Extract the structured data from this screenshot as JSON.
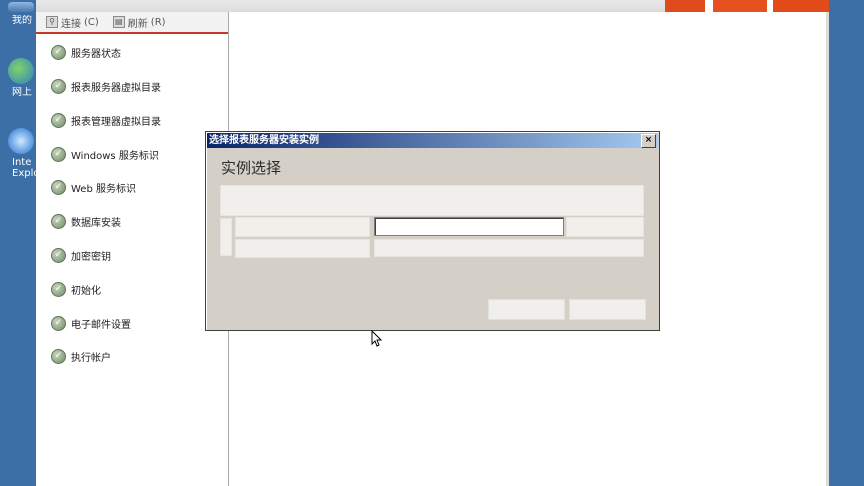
{
  "desktop": {
    "icons": [
      {
        "label": "我的",
        "icon": "my-computer-icon"
      },
      {
        "label": "网上",
        "icon": "network-places-icon"
      },
      {
        "label": "Inte",
        "icon": "internet-explorer-icon"
      },
      {
        "label": "Explo",
        "icon": "internet-explorer-icon"
      }
    ]
  },
  "toolbar": {
    "connect_label": "连接",
    "connect_shortcut": "(C)",
    "refresh_label": "刷新",
    "refresh_shortcut": "(R)"
  },
  "steps": [
    {
      "label": "服务器状态"
    },
    {
      "label": "报表服务器虚拟目录"
    },
    {
      "label": "报表管理器虚拟目录"
    },
    {
      "label": "Windows 服务标识"
    },
    {
      "label": "Web 服务标识"
    },
    {
      "label": "数据库安装"
    },
    {
      "label": "加密密钥"
    },
    {
      "label": "初始化"
    },
    {
      "label": "电子邮件设置"
    },
    {
      "label": "执行帐户"
    }
  ],
  "dialog": {
    "title": "选择报表服务器安装实例",
    "close_glyph": "×",
    "heading": "实例选择"
  },
  "colors": {
    "desktop_bg": "#3b6fa6",
    "title_gradient_start": "#0a246a",
    "dialog_bg": "#d4d0c8",
    "toolbar_underline": "#c0392b",
    "window_buttons": "#e24a1a"
  }
}
